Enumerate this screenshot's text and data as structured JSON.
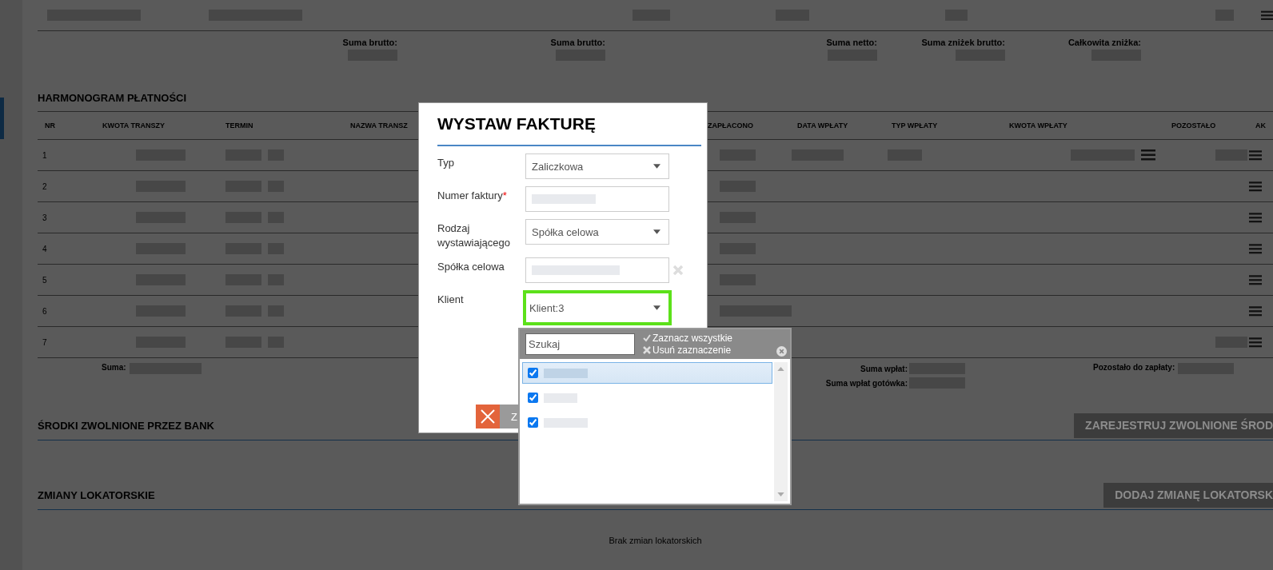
{
  "totals": [
    {
      "label": "Suma brutto:"
    },
    {
      "label": "Suma brutto:"
    },
    {
      "label": "Suma netto:"
    },
    {
      "label": "Suma zniżek brutto:"
    },
    {
      "label": "Całkowita zniżka:"
    }
  ],
  "payment_schedule": {
    "title": "HARMONOGRAM PŁATNOŚCI",
    "columns": [
      "NR",
      "KWOTA TRANSZY",
      "TERMIN",
      "NAZWA TRANSZ",
      "ZAPŁACONO",
      "DATA WPŁATY",
      "TYP WPŁATY",
      "KWOTA WPŁATY",
      "POZOSTAŁO",
      "AK"
    ],
    "rows": [
      {
        "nr": "1"
      },
      {
        "nr": "2"
      },
      {
        "nr": "3"
      },
      {
        "nr": "4"
      },
      {
        "nr": "5"
      },
      {
        "nr": "6"
      },
      {
        "nr": "7"
      }
    ],
    "sum_label": "Suma:",
    "payments_sum_label": "Suma wpłat:",
    "cash_payments_sum_label": "Suma wpłat gotówka:",
    "remaining_label": "Pozostało do zapłaty:"
  },
  "bank_funds": {
    "title": "ŚRODKI ZWOLNIONE PRZEZ BANK",
    "button": "ZAREJESTRUJ ZWOLNIONE ŚROD"
  },
  "tenant_changes": {
    "title": "ZMIANY LOKATORSKIE",
    "button": "DODAJ ZMIANĘ LOKATORSK",
    "empty_message": "Brak zmian lokatorskich"
  },
  "dialog": {
    "title": "WYSTAW FAKTURĘ",
    "fields": [
      {
        "label": "Typ",
        "kind": "select",
        "value": "Zaliczkowa",
        "focused": false
      },
      {
        "label": "Numer faktury",
        "kind": "text",
        "required_mark": "*",
        "focused": false
      },
      {
        "label": "Rodzaj wystawiającego",
        "kind": "select",
        "value": "Spółka celowa",
        "focused": false
      },
      {
        "label": "Spółka celowa",
        "kind": "lookup",
        "focused": false
      },
      {
        "label": "Klient",
        "kind": "select",
        "value": "Klient:3",
        "focused": true
      }
    ],
    "second_button": "Z"
  },
  "client_dropdown": {
    "search_placeholder": "Szukaj",
    "select_all": "Zaznacz wszystkie",
    "clear_selection": "Usuń zaznaczenie",
    "options": [
      {
        "checked": true,
        "selected": true
      },
      {
        "checked": true,
        "selected": false
      },
      {
        "checked": true,
        "selected": false
      }
    ]
  }
}
